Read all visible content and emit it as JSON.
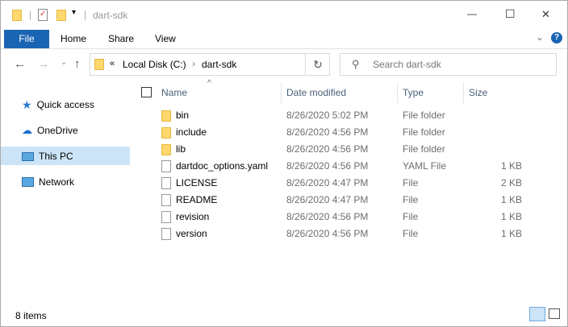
{
  "window": {
    "title": "dart-sdk",
    "minimize": "—",
    "maximize": "☐",
    "close": "✕"
  },
  "ribbon": {
    "tabs": [
      "File",
      "Home",
      "Share",
      "View"
    ],
    "help": "?",
    "collapse": "⌄"
  },
  "address": {
    "prefix": "«",
    "crumbs": [
      "Local Disk (C:)",
      "dart-sdk"
    ],
    "separator": "›",
    "refresh": "↻"
  },
  "search": {
    "placeholder": "Search dart-sdk"
  },
  "nav_buttons": {
    "back": "←",
    "forward": "→",
    "recent": "⌄",
    "up": "↑"
  },
  "sidebar": {
    "items": [
      {
        "label": "Quick access",
        "icon": "star-icon",
        "selected": false
      },
      {
        "label": "OneDrive",
        "icon": "cloud-icon",
        "selected": false
      },
      {
        "label": "This PC",
        "icon": "computer-icon",
        "selected": true
      },
      {
        "label": "Network",
        "icon": "network-icon",
        "selected": false
      }
    ]
  },
  "columns": {
    "name": "Name",
    "date": "Date modified",
    "type": "Type",
    "size": "Size",
    "sort_arrow": "^"
  },
  "files": [
    {
      "name": "bin",
      "date": "8/26/2020 5:02 PM",
      "type": "File folder",
      "size": "",
      "folder": true
    },
    {
      "name": "include",
      "date": "8/26/2020 4:56 PM",
      "type": "File folder",
      "size": "",
      "folder": true
    },
    {
      "name": "lib",
      "date": "8/26/2020 4:56 PM",
      "type": "File folder",
      "size": "",
      "folder": true
    },
    {
      "name": "dartdoc_options.yaml",
      "date": "8/26/2020 4:56 PM",
      "type": "YAML File",
      "size": "1 KB",
      "folder": false
    },
    {
      "name": "LICENSE",
      "date": "8/26/2020 4:47 PM",
      "type": "File",
      "size": "2 KB",
      "folder": false
    },
    {
      "name": "README",
      "date": "8/26/2020 4:47 PM",
      "type": "File",
      "size": "1 KB",
      "folder": false
    },
    {
      "name": "revision",
      "date": "8/26/2020 4:56 PM",
      "type": "File",
      "size": "1 KB",
      "folder": false
    },
    {
      "name": "version",
      "date": "8/26/2020 4:56 PM",
      "type": "File",
      "size": "1 KB",
      "folder": false
    }
  ],
  "status": {
    "count": "8 items"
  }
}
